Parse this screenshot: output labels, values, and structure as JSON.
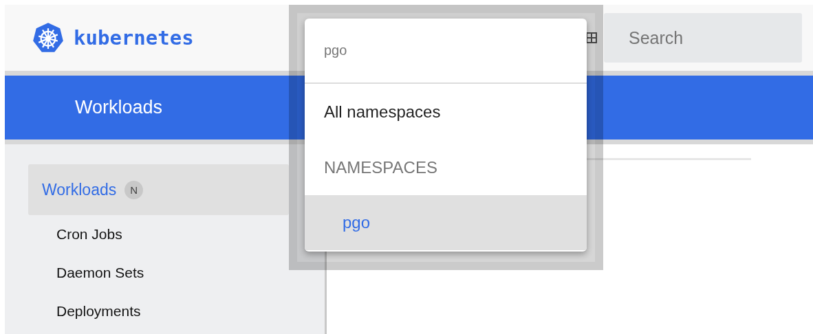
{
  "header": {
    "logo_text": "kubernetes",
    "search": {
      "placeholder": "Search"
    }
  },
  "title_bar": {
    "title": "Workloads"
  },
  "sidebar": {
    "items": [
      {
        "label": "Workloads",
        "badge": "N",
        "selected": true,
        "children": [
          {
            "label": "Cron Jobs",
            "selected": false
          },
          {
            "label": "Daemon Sets",
            "selected": false
          },
          {
            "label": "Deployments",
            "selected": false
          }
        ]
      }
    ]
  },
  "namespace_dropdown": {
    "value": "pgo",
    "options": [
      {
        "kind": "option",
        "label": "All namespaces",
        "selected": false
      },
      {
        "kind": "heading",
        "label": "NAMESPACES"
      },
      {
        "kind": "option",
        "label": "pgo",
        "selected": true
      }
    ]
  }
}
